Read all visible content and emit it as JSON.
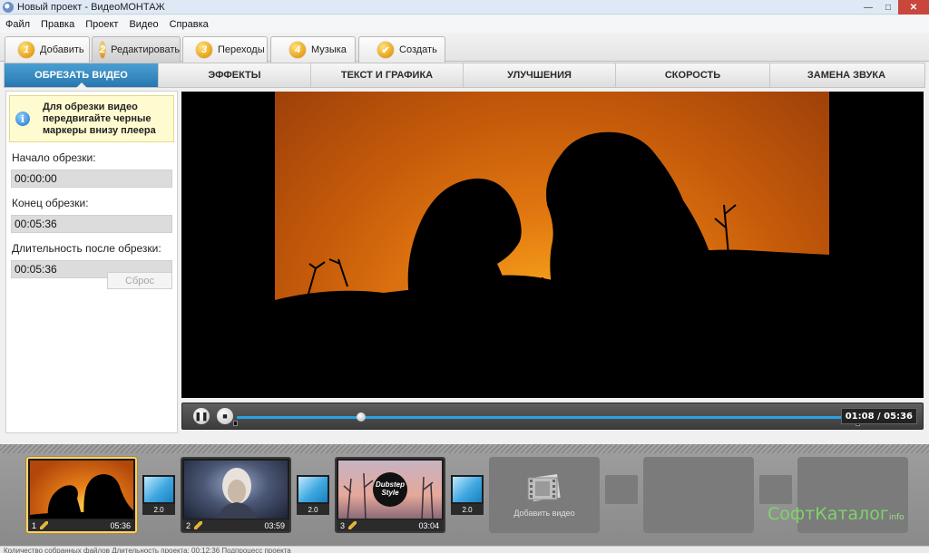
{
  "window": {
    "title": "Новый проект - ВидеоМОНТАЖ"
  },
  "menu": [
    "Файл",
    "Правка",
    "Проект",
    "Видео",
    "Справка"
  ],
  "steps": [
    {
      "num": "1",
      "label": "Добавить"
    },
    {
      "num": "2",
      "label": "Редактировать"
    },
    {
      "num": "3",
      "label": "Переходы"
    },
    {
      "num": "4",
      "label": "Музыка"
    },
    {
      "num": "✔",
      "label": "Создать"
    }
  ],
  "subtabs": [
    "ОБРЕЗАТЬ ВИДЕО",
    "ЭФФЕКТЫ",
    "ТЕКСТ И ГРАФИКА",
    "УЛУЧШЕНИЯ",
    "СКОРОСТЬ",
    "ЗАМЕНА ЗВУКА"
  ],
  "trim": {
    "hint": "Для обрезки видео передвигайте черные маркеры внизу плеера",
    "start_label": "Начало обрезки:",
    "start_value": "00:00:00",
    "end_label": "Конец обрезки:",
    "end_value": "00:05:36",
    "duration_label": "Длительность после обрезки:",
    "duration_value": "00:05:36",
    "reset_label": "Сброс"
  },
  "player": {
    "timecode": "01:08 / 05:36",
    "progress": 0.2
  },
  "timeline": {
    "clips": [
      {
        "index": "1",
        "duration": "05:36"
      },
      {
        "index": "2",
        "duration": "03:59"
      },
      {
        "index": "3",
        "duration": "03:04"
      }
    ],
    "transitions": [
      "2.0",
      "2.0",
      "2.0"
    ],
    "add_video_label": "Добавить видео",
    "thumb3_text": "Dubstep Style"
  },
  "watermark": {
    "main": "СофтКаталог",
    "sub": "info"
  },
  "statusbar": "Количество собранных файлов   Длительность проекта: 00:12:36   Подпроцесс проекта"
}
